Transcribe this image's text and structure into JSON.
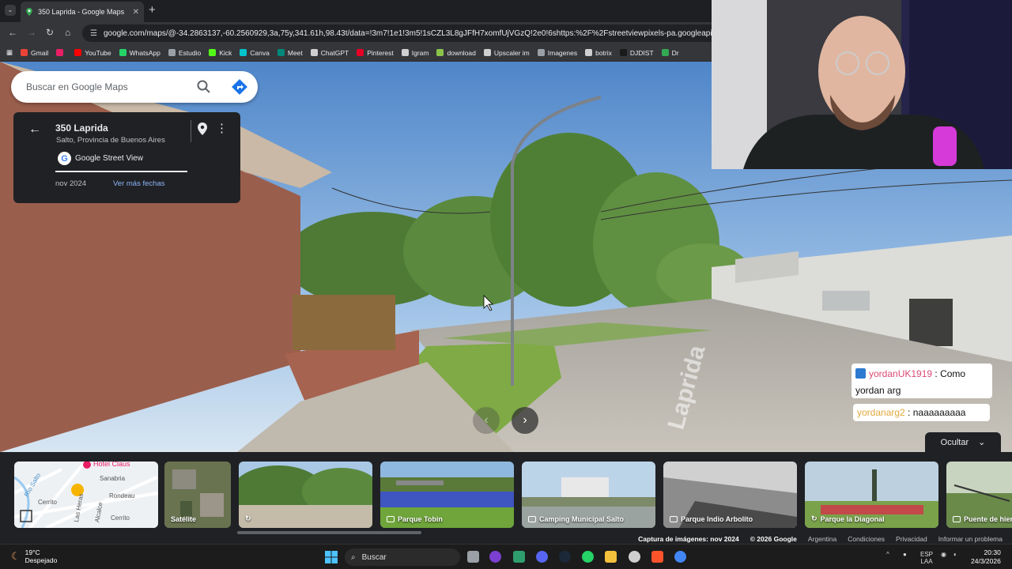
{
  "browser": {
    "tab_title": "350 Laprida - Google Maps",
    "url": "google.com/maps/@-34.2863137,-60.2560929,3a,75y,341.61h,98.43t/data=!3m7!1e1!3m5!1sCZL3L8gJFfH7xomfUjVGzQ!2e0!6shttps:%2F%2Fstreetviewpixels-pa.googleapis.com%2Fv1%2Ft",
    "bookmarks": [
      {
        "label": "Gmail",
        "color": "#ea4335"
      },
      {
        "label": "",
        "color": "#e91e63"
      },
      {
        "label": "YouTube",
        "color": "#ff0000"
      },
      {
        "label": "WhatsApp",
        "color": "#25d366"
      },
      {
        "label": "Estudio",
        "color": "#9aa0a6"
      },
      {
        "label": "Kick",
        "color": "#53fc18"
      },
      {
        "label": "Canva",
        "color": "#00c4cc"
      },
      {
        "label": "Meet",
        "color": "#00897b"
      },
      {
        "label": "ChatGPT",
        "color": "#cfcfcf"
      },
      {
        "label": "Pinterest",
        "color": "#e60023"
      },
      {
        "label": "Igram",
        "color": "#cfcfcf"
      },
      {
        "label": "download",
        "color": "#8bc34a"
      },
      {
        "label": "Upscaler im",
        "color": "#cfcfcf"
      },
      {
        "label": "Imagenes",
        "color": "#9aa0a6"
      },
      {
        "label": "botrix",
        "color": "#cfcfcf"
      },
      {
        "label": "DJDIST",
        "color": "#1a1a1a"
      },
      {
        "label": "Dr",
        "color": "#34a853"
      }
    ]
  },
  "search": {
    "placeholder": "Buscar en Google Maps"
  },
  "infocard": {
    "title": "350 Laprida",
    "subtitle": "Salto, Provincia de Buenos Aires",
    "source": "Google Street View",
    "date": "nov 2024",
    "more_dates": "Ver más fechas"
  },
  "chat": [
    {
      "user": "yordanUK1919",
      "message": "Como yordan arg"
    },
    {
      "user": "yordanarg2",
      "message": "naaaaaaaaa"
    }
  ],
  "scene": {
    "street_name": "Laprida"
  },
  "hide_button": "Ocultar",
  "thumbnails": [
    {
      "label": "",
      "kind": "map",
      "map_label": "Hotel Claus",
      "streets": [
        "Sanabria",
        "Rondeau",
        "Cerrito",
        "Cerrito",
        "Río Salto",
        "Las Heras",
        "Alcalce"
      ]
    },
    {
      "label": "Satélite",
      "kind": "satellite"
    },
    {
      "label": "",
      "kind": "street"
    },
    {
      "label": "Parque Tobin",
      "kind": "photo"
    },
    {
      "label": "Camping Municipal Salto",
      "kind": "photo"
    },
    {
      "label": "Parque Indio Arbolito",
      "kind": "photo"
    },
    {
      "label": "Parque la Diagonal",
      "kind": "street"
    },
    {
      "label": "Puente de hierro",
      "kind": "photo"
    }
  ],
  "footer": {
    "capture": "Captura de imágenes: nov 2024",
    "copyright": "© 2026 Google",
    "links": [
      "Argentina",
      "Condiciones",
      "Privacidad",
      "Informar un problema"
    ]
  },
  "taskbar": {
    "temperature": "19°C",
    "weather": "Despejado",
    "search": "Buscar",
    "lang": "ESP",
    "lang2": "LAA",
    "time": "20:30",
    "date": "24/3/2026"
  }
}
